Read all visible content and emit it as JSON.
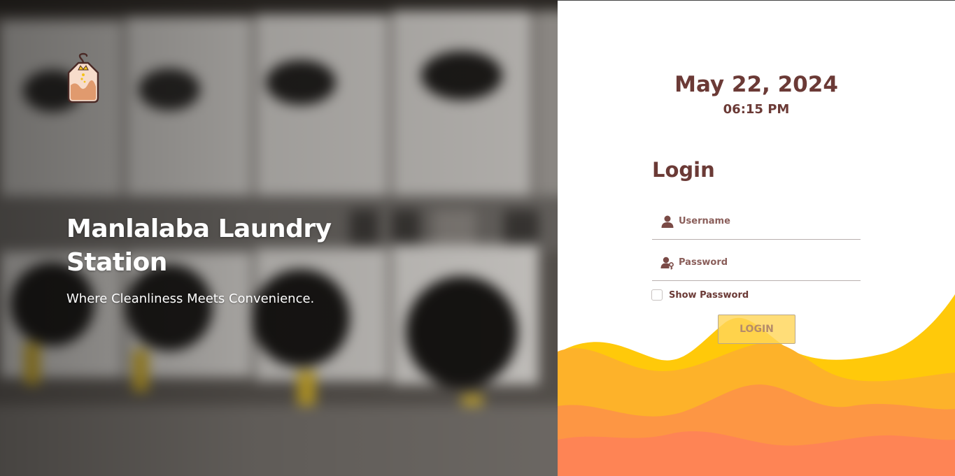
{
  "hero": {
    "title": "Manlalaba Laundry Station",
    "tagline": "Where Cleanliness Meets Convenience.",
    "logo_icon": "laundry-bag-hanger-logo-icon"
  },
  "clock": {
    "date": "May 22, 2024",
    "time": "06:15 PM"
  },
  "login": {
    "heading": "Login",
    "username_placeholder": "Username",
    "password_placeholder": "Password",
    "show_password_label": "Show Password",
    "show_password_checked": false,
    "button_label": "LOGIN",
    "username_icon": "user-icon",
    "password_icon": "user-key-icon"
  },
  "colors": {
    "brand_brown": "#6b3a36",
    "button_yellow": "#ffd65a",
    "wave_gold": "#ffc90a",
    "wave_amber": "#fdb22a",
    "wave_orange": "#fd9644",
    "wave_coral": "#fe8455"
  }
}
